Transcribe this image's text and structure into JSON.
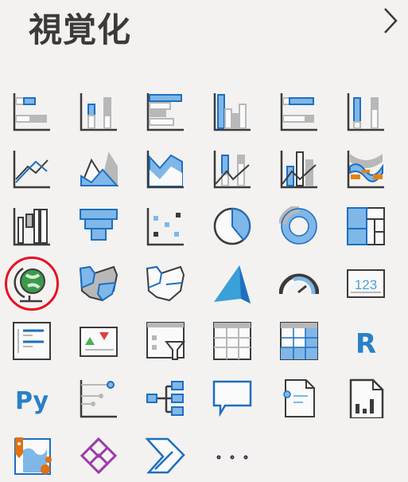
{
  "pane": {
    "title": "視覚化",
    "expand_icon": "chevron-right-icon"
  },
  "colors": {
    "blue_fill": "#7fb7e8",
    "blue_stroke": "#1e6fc0",
    "dark": "#3b3b3b",
    "gray": "#b8b8b8",
    "highlight": "#e81123"
  },
  "highlighted_visual": "map",
  "visuals": [
    {
      "id": "stacked-bar-chart"
    },
    {
      "id": "stacked-column-chart"
    },
    {
      "id": "clustered-bar-chart"
    },
    {
      "id": "clustered-column-chart"
    },
    {
      "id": "100-stacked-bar-chart"
    },
    {
      "id": "100-stacked-column-chart"
    },
    {
      "id": "line-chart"
    },
    {
      "id": "area-chart"
    },
    {
      "id": "stacked-area-chart"
    },
    {
      "id": "line-and-stacked-column-chart"
    },
    {
      "id": "line-and-clustered-column-chart"
    },
    {
      "id": "ribbon-chart"
    },
    {
      "id": "waterfall-chart"
    },
    {
      "id": "funnel"
    },
    {
      "id": "scatter-chart"
    },
    {
      "id": "pie-chart"
    },
    {
      "id": "donut-chart"
    },
    {
      "id": "treemap"
    },
    {
      "id": "map"
    },
    {
      "id": "filled-map"
    },
    {
      "id": "shape-map"
    },
    {
      "id": "azure-map"
    },
    {
      "id": "gauge"
    },
    {
      "id": "card",
      "text": "123"
    },
    {
      "id": "multi-row-card"
    },
    {
      "id": "kpi"
    },
    {
      "id": "slicer"
    },
    {
      "id": "table"
    },
    {
      "id": "matrix"
    },
    {
      "id": "r-script-visual",
      "text": "R"
    },
    {
      "id": "python-visual",
      "text": "Py"
    },
    {
      "id": "key-influencers"
    },
    {
      "id": "decomposition-tree"
    },
    {
      "id": "q-and-a"
    },
    {
      "id": "smart-narrative"
    },
    {
      "id": "paginated-report"
    },
    {
      "id": "arcgis-map"
    },
    {
      "id": "power-apps"
    },
    {
      "id": "power-automate"
    },
    {
      "id": "more-visuals",
      "text": "..."
    }
  ]
}
